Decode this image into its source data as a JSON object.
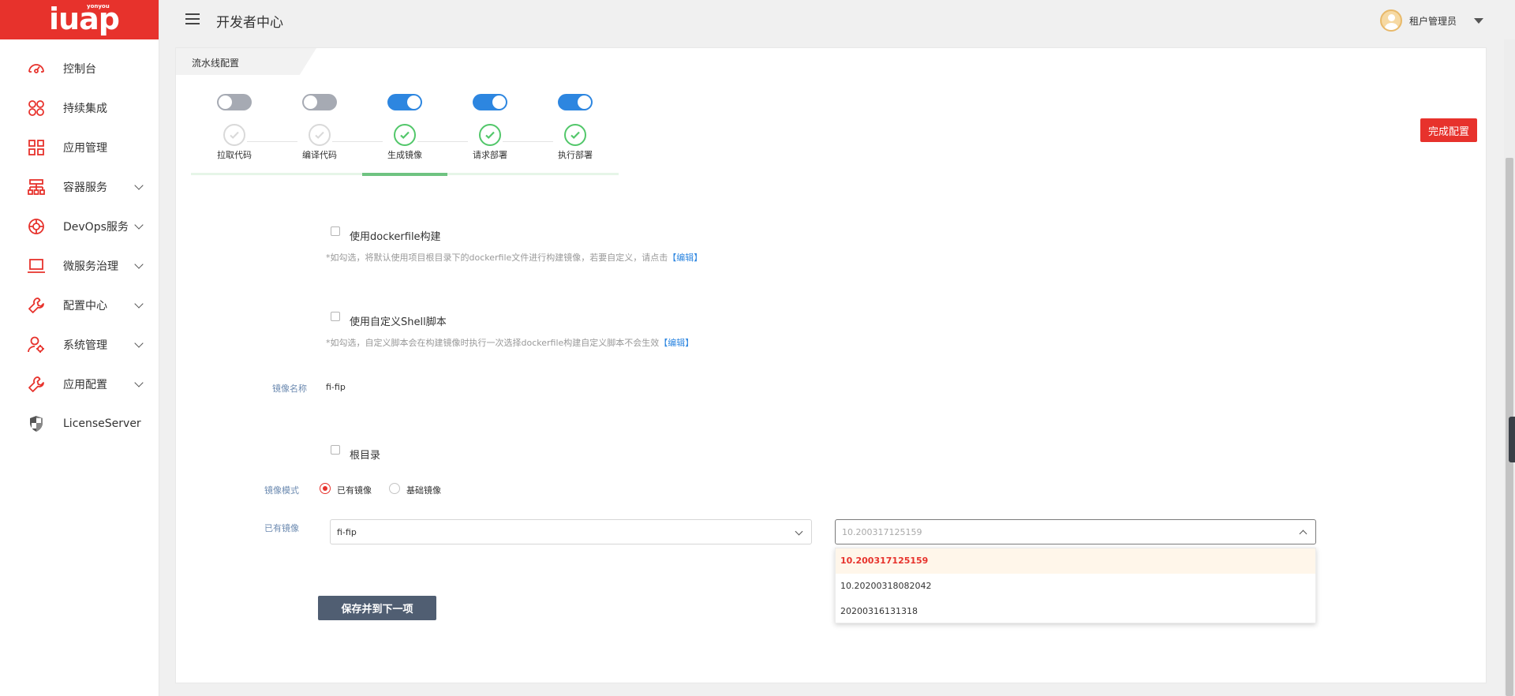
{
  "app": {
    "logo_text": "iuap",
    "logo_sub": "yonyou",
    "header_title": "开发者中心",
    "user_name": "租户管理员"
  },
  "sidebar": {
    "items": [
      {
        "label": "控制台",
        "icon": "dashboard-icon",
        "has_submenu": false
      },
      {
        "label": "持续集成",
        "icon": "integration-icon",
        "has_submenu": false
      },
      {
        "label": "应用管理",
        "icon": "grid-icon",
        "has_submenu": false
      },
      {
        "label": "容器服务",
        "icon": "container-icon",
        "has_submenu": true
      },
      {
        "label": "DevOps服务",
        "icon": "devops-icon",
        "has_submenu": true
      },
      {
        "label": "微服务治理",
        "icon": "laptop-icon",
        "has_submenu": true
      },
      {
        "label": "配置中心",
        "icon": "wrench-icon",
        "has_submenu": true
      },
      {
        "label": "系统管理",
        "icon": "user-gear-icon",
        "has_submenu": true
      },
      {
        "label": "应用配置",
        "icon": "wrench-icon",
        "has_submenu": true
      },
      {
        "label": "LicenseServer",
        "icon": "shield-icon",
        "has_submenu": false
      }
    ]
  },
  "card": {
    "tab_label": "流水线配置",
    "finish_button": "完成配置"
  },
  "steps": [
    {
      "label": "拉取代码",
      "enabled": false,
      "done": false
    },
    {
      "label": "编译代码",
      "enabled": false,
      "done": false
    },
    {
      "label": "生成镜像",
      "enabled": true,
      "done": true,
      "active": true
    },
    {
      "label": "请求部署",
      "enabled": true,
      "done": true
    },
    {
      "label": "执行部署",
      "enabled": true,
      "done": true
    }
  ],
  "form": {
    "dockerfile": {
      "label": "使用dockerfile构建",
      "checked": false,
      "hint": "*如勾选，将默认使用项目根目录下的dockerfile文件进行构建镜像，若要自定义，请点击",
      "link": "【编辑】"
    },
    "shell": {
      "label": "使用自定义Shell脚本",
      "checked": false,
      "hint": "*如勾选，自定义脚本会在构建镜像时执行一次选择dockerfile构建自定义脚本不会生效",
      "link": "【编辑】"
    },
    "image_name": {
      "label": "镜像名称",
      "value": "fi-fip"
    },
    "root_dir": {
      "label": "根目录",
      "checked": false
    },
    "image_mode": {
      "label": "镜像模式",
      "options": [
        "已有镜像",
        "基础镜像"
      ],
      "selected": "已有镜像"
    },
    "existing_image": {
      "label": "已有镜像",
      "name_value": "fi-fip",
      "version_placeholder": "10.200317125159",
      "version_options": [
        "10.200317125159",
        "10.20200318082042",
        "20200316131318"
      ],
      "version_selected": "10.200317125159"
    },
    "save_button": "保存并到下一项"
  },
  "colors": {
    "brand": "#e7322c",
    "toggle_on": "#2d86e0",
    "toggle_off": "#a6aab3",
    "step_done": "#52c76a",
    "save_button": "#505e72"
  }
}
